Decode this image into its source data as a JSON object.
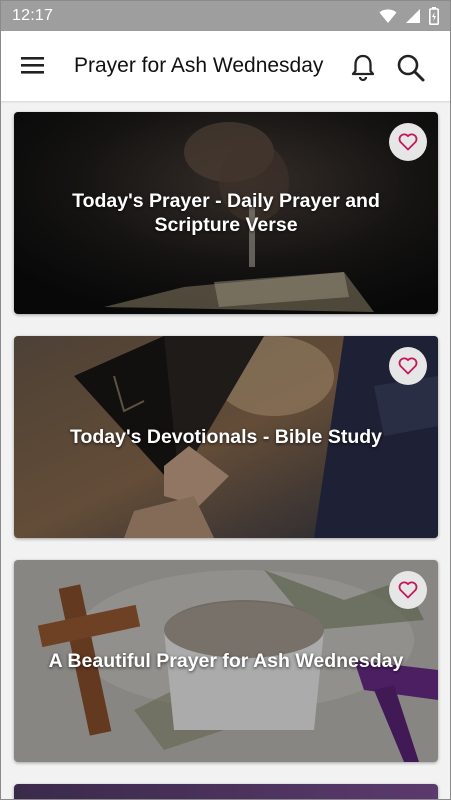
{
  "status_bar": {
    "time": "12:17"
  },
  "app_bar": {
    "title": "Prayer for Ash Wednesday",
    "icons": [
      "menu-icon",
      "bell-icon",
      "search-icon"
    ]
  },
  "cards": [
    {
      "title": "Today's Prayer - Daily Prayer and Scripture Verse",
      "favorite_icon": "heart-outline-icon"
    },
    {
      "title": "Today's Devotionals - Bible Study",
      "favorite_icon": "heart-outline-icon"
    },
    {
      "title": "A Beautiful Prayer for Ash Wednesday",
      "favorite_icon": "heart-outline-icon"
    }
  ],
  "colors": {
    "status_bar": "#9e9e9e",
    "app_bar": "#ffffff",
    "background": "#f2f2f2",
    "heart": "#c2185b"
  }
}
